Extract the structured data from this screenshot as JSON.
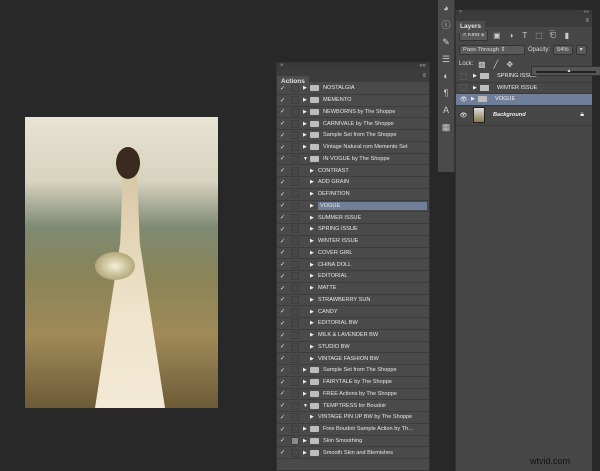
{
  "actions_panel": {
    "title": "Actions",
    "close": "×",
    "collapse": "««",
    "menu": "≡",
    "rows": [
      {
        "label": "NOSTALGIA",
        "type": "set",
        "expanded": false,
        "dialog": false
      },
      {
        "label": "MEMENTO",
        "type": "set",
        "expanded": false,
        "dialog": false
      },
      {
        "label": "NEWBORNS by The Shoppe",
        "type": "set",
        "expanded": false,
        "dialog": false
      },
      {
        "label": "CARNIVALE by The Shoppe",
        "type": "set",
        "expanded": false,
        "dialog": false
      },
      {
        "label": "Sample Set from The Shoppe",
        "type": "set",
        "expanded": false,
        "dialog": false
      },
      {
        "label": "Vintage Natural rom Memento Set",
        "type": "set",
        "expanded": false,
        "dialog": false
      },
      {
        "label": "IN VOGUE by The Shoppe",
        "type": "set",
        "expanded": true,
        "dialog": false
      },
      {
        "label": "CONTRAST",
        "type": "action",
        "dialog": false
      },
      {
        "label": "ADD GRAIN",
        "type": "action",
        "dialog": false
      },
      {
        "label": "DEFINITION",
        "type": "action",
        "dialog": false
      },
      {
        "label": "VOGUE",
        "type": "action",
        "selected": true,
        "dialog": false
      },
      {
        "label": "SUMMER ISSUE",
        "type": "action",
        "dialog": false
      },
      {
        "label": "SPRING ISSUE",
        "type": "action",
        "dialog": false
      },
      {
        "label": "WINTER ISSUE",
        "type": "action",
        "dialog": false
      },
      {
        "label": "COVER GIRL",
        "type": "action",
        "dialog": false
      },
      {
        "label": "CHINA DOLL",
        "type": "action",
        "dialog": false
      },
      {
        "label": "EDITORIAL",
        "type": "action",
        "dialog": false
      },
      {
        "label": "MATTE",
        "type": "action",
        "dialog": false
      },
      {
        "label": "STRAWBERRY SUN",
        "type": "action",
        "dialog": false
      },
      {
        "label": "CANDY",
        "type": "action",
        "dialog": false
      },
      {
        "label": "EDITORIAL BW",
        "type": "action",
        "dialog": false
      },
      {
        "label": "MILK & LAVENDER BW",
        "type": "action",
        "dialog": false
      },
      {
        "label": "STUDIO BW",
        "type": "action",
        "dialog": false
      },
      {
        "label": "VINTAGE FASHION BW",
        "type": "action",
        "dialog": false
      },
      {
        "label": "Sample Set from The Shoppe",
        "type": "set",
        "expanded": false,
        "dialog": false
      },
      {
        "label": "FAIRYTALE by The Shoppe",
        "type": "set",
        "expanded": false,
        "dialog": false
      },
      {
        "label": "FREE Actions by The Shoppe",
        "type": "set",
        "expanded": false,
        "dialog": false
      },
      {
        "label": "TEMPTRESS for Boudoir",
        "type": "set",
        "expanded": true,
        "dialog": false
      },
      {
        "label": "VINTAGE PIN UP BW by The Shoppe",
        "type": "action",
        "dialog": false
      },
      {
        "label": "Free Boudoir Sample Action by Th...",
        "type": "set",
        "expanded": false,
        "dialog": false
      },
      {
        "label": "Skin Smoothing",
        "type": "set",
        "expanded": false,
        "dialog": true
      },
      {
        "label": "Smooth Skin and Blemishes",
        "type": "set",
        "expanded": false,
        "dialog": false
      }
    ]
  },
  "layers_panel": {
    "title": "Layers",
    "close": "×",
    "collapse": "««",
    "menu": "≡",
    "filter_kind": "Kind",
    "blend_mode": "Pass Through",
    "opacity_label": "Opacity:",
    "opacity_value": "54%",
    "opacity_percent": 54,
    "lock_label": "Lock:",
    "layers": [
      {
        "name": "SPRING ISSUE",
        "type": "group",
        "visible": false
      },
      {
        "name": "WINTER ISSUE",
        "type": "group",
        "visible": false
      },
      {
        "name": "VOGUE",
        "type": "group",
        "visible": true,
        "selected": true
      },
      {
        "name": "Background",
        "type": "image",
        "visible": true,
        "locked": true
      }
    ]
  },
  "watermark": "wtvid.com",
  "colors": {
    "selection": "#6f7f99",
    "panel": "#4a4a4a",
    "background": "#282828"
  }
}
